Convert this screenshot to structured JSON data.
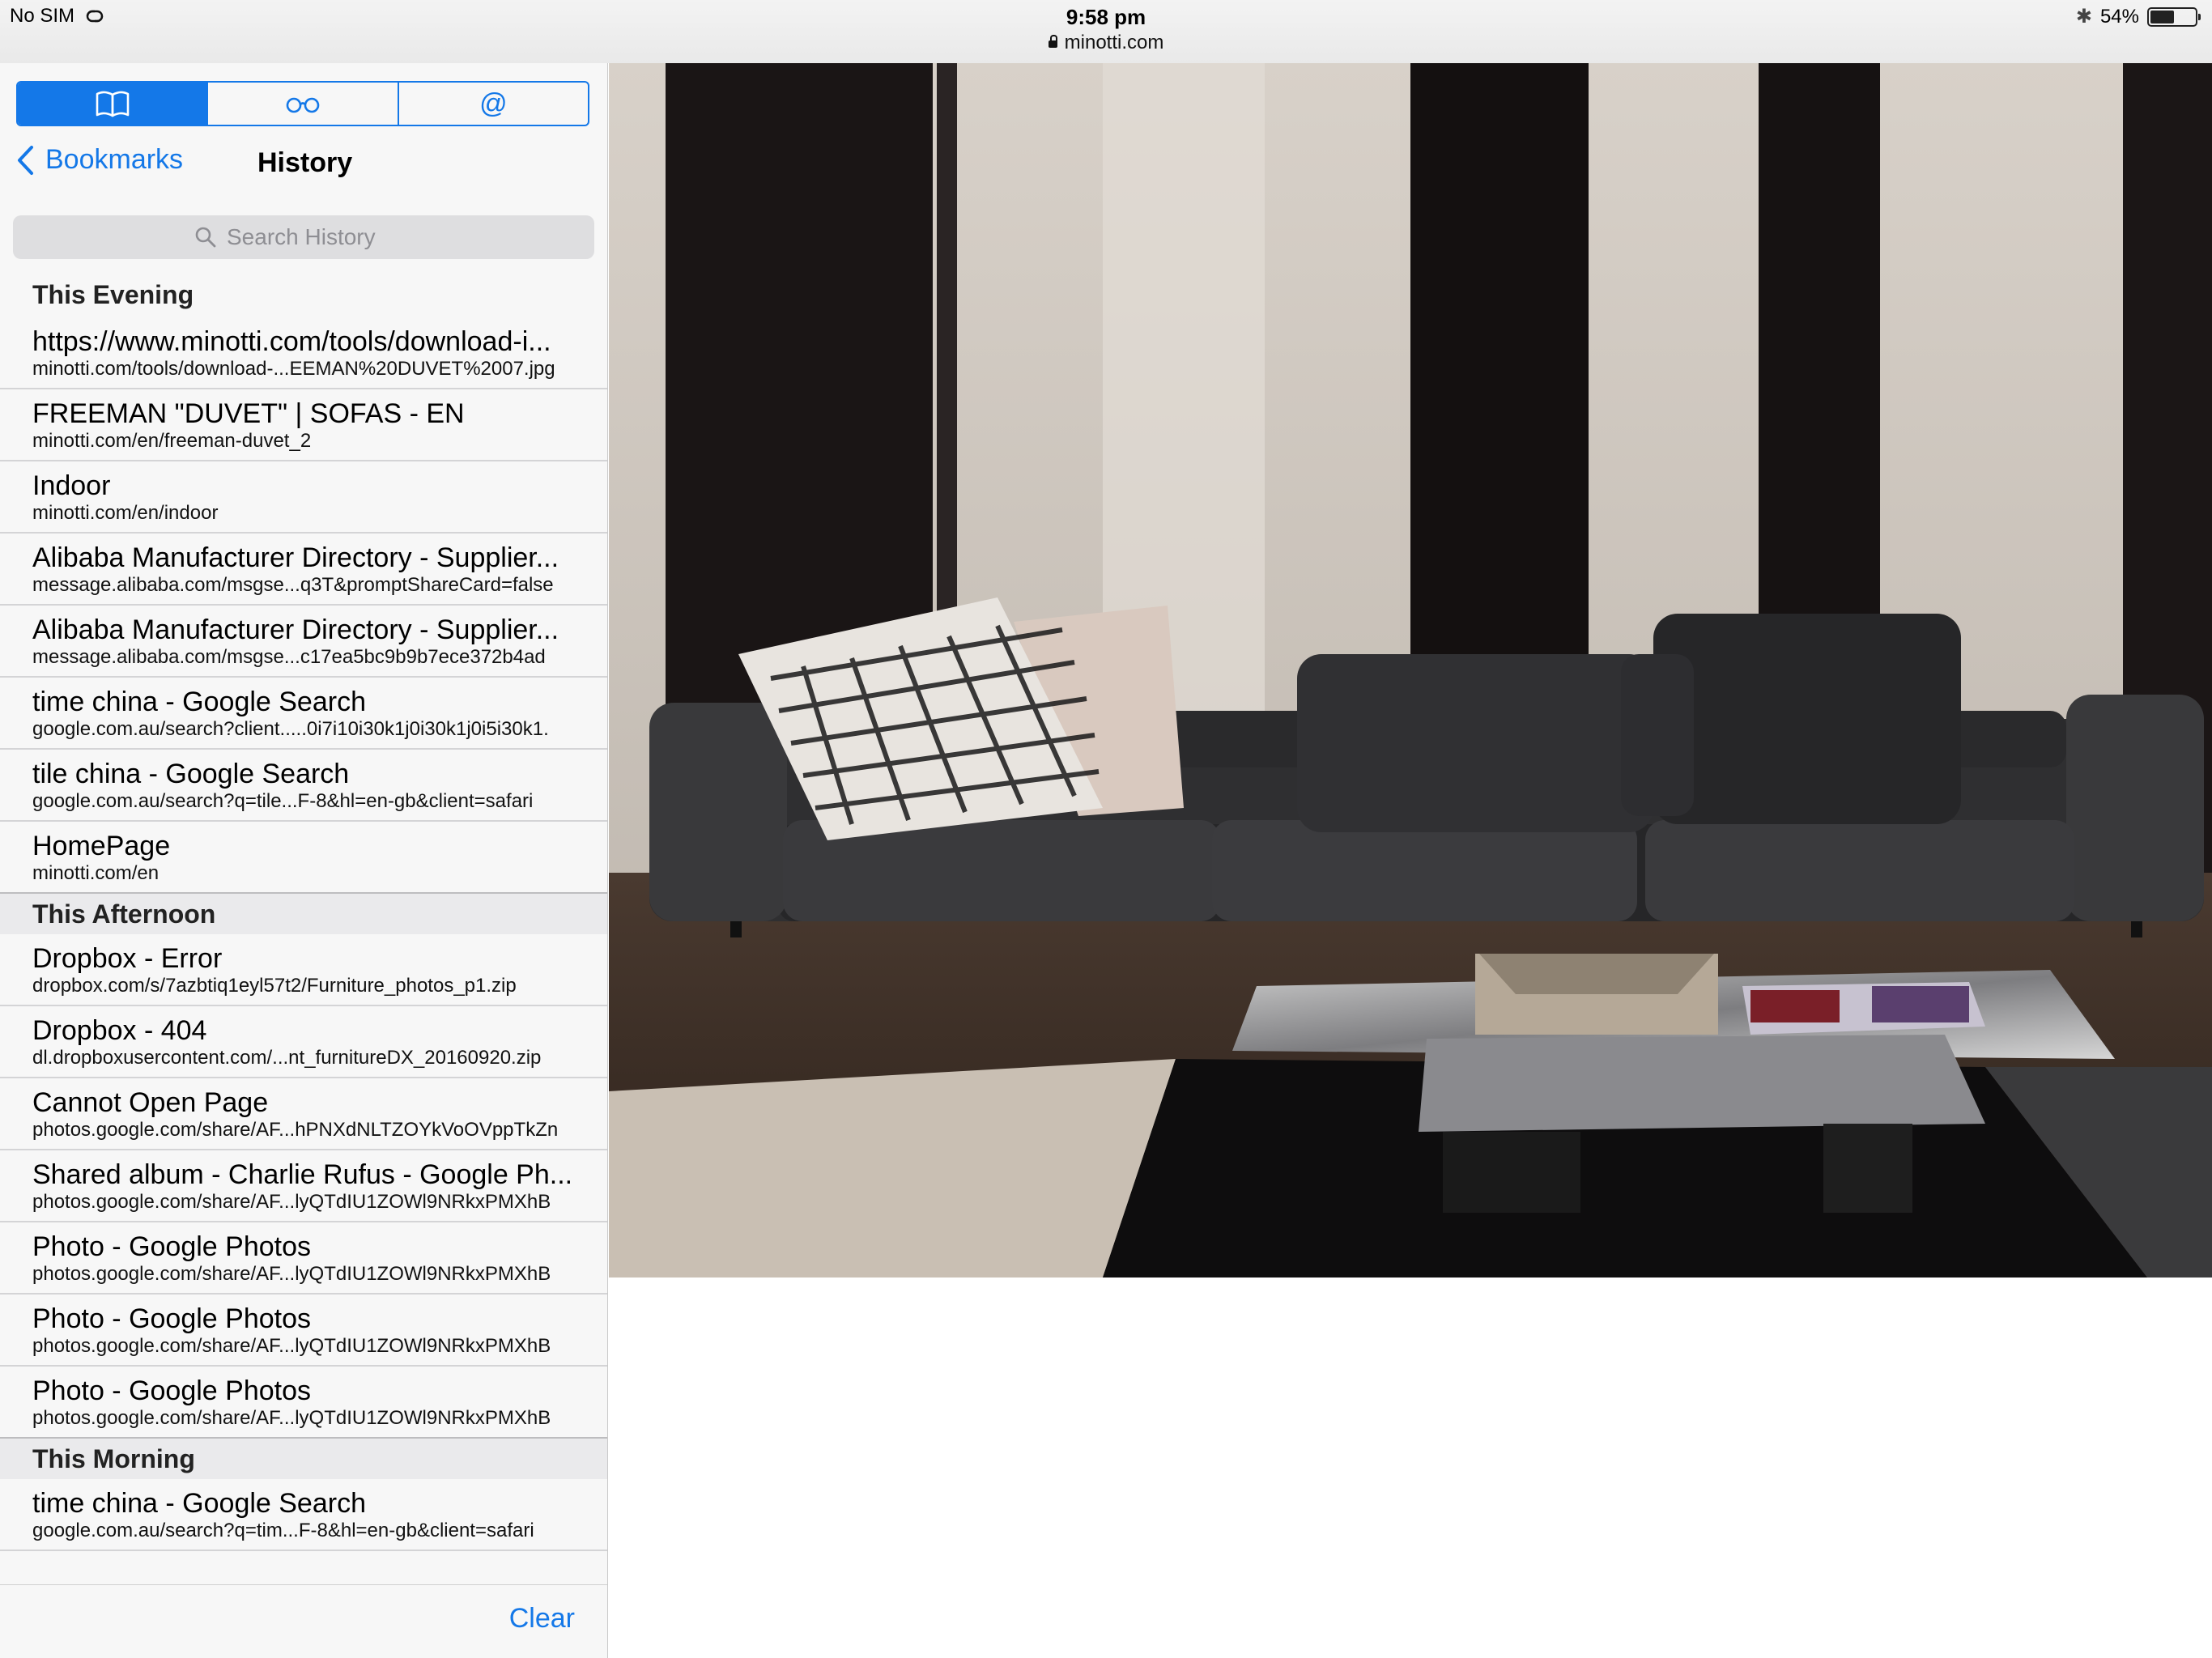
{
  "status_bar": {
    "carrier": "No SIM",
    "time": "9:58 pm",
    "url": "minotti.com",
    "battery": "54%",
    "battery_level": 0.54
  },
  "sidebar": {
    "tabs": [
      {
        "icon": "book-icon",
        "active": true
      },
      {
        "icon": "glasses-icon",
        "active": false
      },
      {
        "icon": "at-icon",
        "active": false,
        "glyph": "@"
      }
    ],
    "back_label": "Bookmarks",
    "title": "History",
    "search_placeholder": "Search History",
    "sections": [
      {
        "label": "This Evening",
        "items": [
          {
            "title": "https://www.minotti.com/tools/download-i...",
            "url": "minotti.com/tools/download-...EEMAN%20DUVET%2007.jpg"
          },
          {
            "title": "FREEMAN \"DUVET\" | SOFAS - EN",
            "url": "minotti.com/en/freeman-duvet_2"
          },
          {
            "title": "Indoor",
            "url": "minotti.com/en/indoor"
          },
          {
            "title": "Alibaba Manufacturer Directory - Supplier...",
            "url": "message.alibaba.com/msgse...q3T&promptShareCard=false"
          },
          {
            "title": "Alibaba Manufacturer Directory - Supplier...",
            "url": "message.alibaba.com/msgse...c17ea5bc9b9b7ece372b4ad"
          },
          {
            "title": "time china - Google Search",
            "url": "google.com.au/search?client.....0i7i10i30k1j0i30k1j0i5i30k1."
          },
          {
            "title": "tile china - Google Search",
            "url": "google.com.au/search?q=tile...F-8&hl=en-gb&client=safari"
          },
          {
            "title": "HomePage",
            "url": "minotti.com/en"
          }
        ]
      },
      {
        "label": "This Afternoon",
        "items": [
          {
            "title": "Dropbox - Error",
            "url": "dropbox.com/s/7azbtiq1eyl57t2/Furniture_photos_p1.zip"
          },
          {
            "title": "Dropbox - 404",
            "url": "dl.dropboxusercontent.com/...nt_furnitureDX_20160920.zip"
          },
          {
            "title": "Cannot Open Page",
            "url": "photos.google.com/share/AF...hPNXdNLTZOYkVoOVppTkZn"
          },
          {
            "title": "Shared album - Charlie Rufus - Google Ph...",
            "url": "photos.google.com/share/AF...lyQTdIU1ZOWl9NRkxPMXhB"
          },
          {
            "title": "Photo - Google Photos",
            "url": "photos.google.com/share/AF...lyQTdIU1ZOWl9NRkxPMXhB"
          },
          {
            "title": "Photo - Google Photos",
            "url": "photos.google.com/share/AF...lyQTdIU1ZOWl9NRkxPMXhB"
          },
          {
            "title": "Photo - Google Photos",
            "url": "photos.google.com/share/AF...lyQTdIU1ZOWl9NRkxPMXhB"
          }
        ]
      },
      {
        "label": "This Morning",
        "items": [
          {
            "title": "time china - Google Search",
            "url": "google.com.au/search?q=tim...F-8&hl=en-gb&client=safari"
          }
        ]
      }
    ],
    "clear_label": "Clear"
  },
  "content": {
    "image_subject": "sofa-photo"
  },
  "colors": {
    "accent": "#1478e8",
    "sidebar_bg": "#f7f7f7",
    "section_bg": "#eaeaec",
    "search_bg": "#dedee0"
  }
}
